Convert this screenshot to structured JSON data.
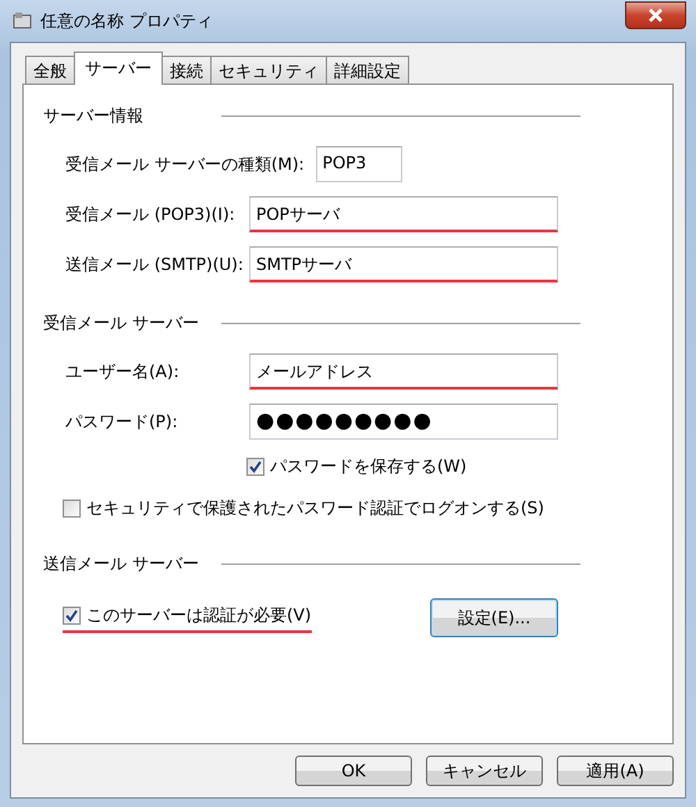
{
  "window": {
    "title": "任意の名称 プロパティ"
  },
  "tabs": [
    {
      "label": "全般",
      "selected": false
    },
    {
      "label": "サーバー",
      "selected": true
    },
    {
      "label": "接続",
      "selected": false
    },
    {
      "label": "セキュリティ",
      "selected": false
    },
    {
      "label": "詳細設定",
      "selected": false
    }
  ],
  "sections": [
    {
      "title": "サーバー情報",
      "rows": [
        {
          "kind": "short_field",
          "label": "受信メール サーバーの種類(M):",
          "value": "POP3",
          "highlighted": false
        },
        {
          "kind": "field",
          "label": "受信メール (POP3)(I):",
          "value": "POPサーバ",
          "highlighted": true
        },
        {
          "kind": "field",
          "label": "送信メール (SMTP)(U):",
          "value": "SMTPサーバ",
          "highlighted": true
        }
      ]
    },
    {
      "title": "受信メール サーバー",
      "rows": [
        {
          "kind": "field",
          "label": "ユーザー名(A):",
          "value": "メールアドレス",
          "highlighted": true
        },
        {
          "kind": "password",
          "label": "パスワード(P):",
          "value": "●●●●●●●●●",
          "highlighted": false
        },
        {
          "kind": "aligned_checkbox",
          "label": "パスワードを保存する(W)",
          "checked": true,
          "highlighted": false
        },
        {
          "kind": "checkbox",
          "label": "セキュリティで保護されたパスワード認証でログオンする(S)",
          "checked": false,
          "highlighted": false
        }
      ]
    },
    {
      "title": "送信メール サーバー",
      "rows": [
        {
          "kind": "checkbox",
          "label": "このサーバーは認証が必要(V)",
          "checked": true,
          "highlighted": true,
          "button": "設定(E)..."
        }
      ]
    }
  ],
  "buttons": [
    {
      "label": "OK",
      "disabled": false
    },
    {
      "label": "キャンセル",
      "disabled": false
    },
    {
      "label": "適用(A)",
      "disabled": false
    }
  ]
}
